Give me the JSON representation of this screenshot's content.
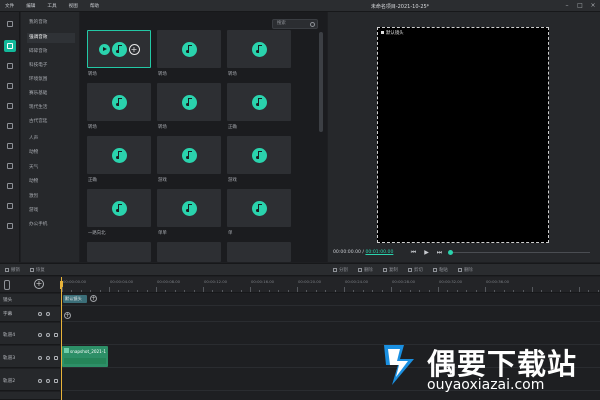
{
  "menubar": {
    "items": [
      "文件",
      "编辑",
      "工具",
      "视图",
      "帮助"
    ],
    "title": "未命名项目-2021-10-25*"
  },
  "categories": {
    "items": [
      "我的音效",
      "强调音效",
      "碎碎音效",
      "科技电子",
      "环境氛围",
      "赛乐基础",
      "现代生活",
      "古代宫廷",
      "人声",
      "动物",
      "天气",
      "动物",
      "激烈",
      "游戏",
      "办公手机"
    ],
    "active_index": 1
  },
  "library": {
    "search_placeholder": "搜索",
    "tiles": [
      {
        "label": "转场",
        "selected": true
      },
      {
        "label": "转场"
      },
      {
        "label": "转场"
      },
      {
        "label": "转场"
      },
      {
        "label": "转场"
      },
      {
        "label": "正确"
      },
      {
        "label": "正确"
      },
      {
        "label": "游戏"
      },
      {
        "label": "游戏"
      },
      {
        "label": "一路向北"
      },
      {
        "label": "单单"
      },
      {
        "label": "单"
      }
    ]
  },
  "preview": {
    "camera_label": "默认镜头",
    "time_current": "00:00:00.00",
    "time_separator": "/",
    "time_total": "00:01:00.00",
    "progress": 0.0
  },
  "toolbar": {
    "undo": "撤销",
    "redo": "恢复",
    "actions": [
      "分割",
      "删除",
      "复制",
      "剪切",
      "粘贴",
      "删除"
    ]
  },
  "ruler": {
    "labels": [
      "00:00:00.00",
      "00:00:04.00",
      "00:00:08.00",
      "00:00:12.00",
      "00:00:16.00",
      "00:00:20.00",
      "00:00:24.00",
      "00:00:28.00",
      "00:00:32.00",
      "00:00:36.00"
    ]
  },
  "tracks": {
    "camera": {
      "name": "镜头",
      "clip": "默认镜头"
    },
    "subtitle": {
      "name": "字幕"
    },
    "track4": {
      "name": "轨道4"
    },
    "track3": {
      "name": "轨道3",
      "clip": "snapshot_2021-1"
    },
    "track2": {
      "name": "轨道2"
    }
  },
  "watermark": {
    "title": "偶要下载站",
    "url": "ouyaoxiazai.com"
  },
  "colors": {
    "accent": "#2ad3ad",
    "playhead": "#e8b33a",
    "clip_green": "#2d8f67"
  }
}
